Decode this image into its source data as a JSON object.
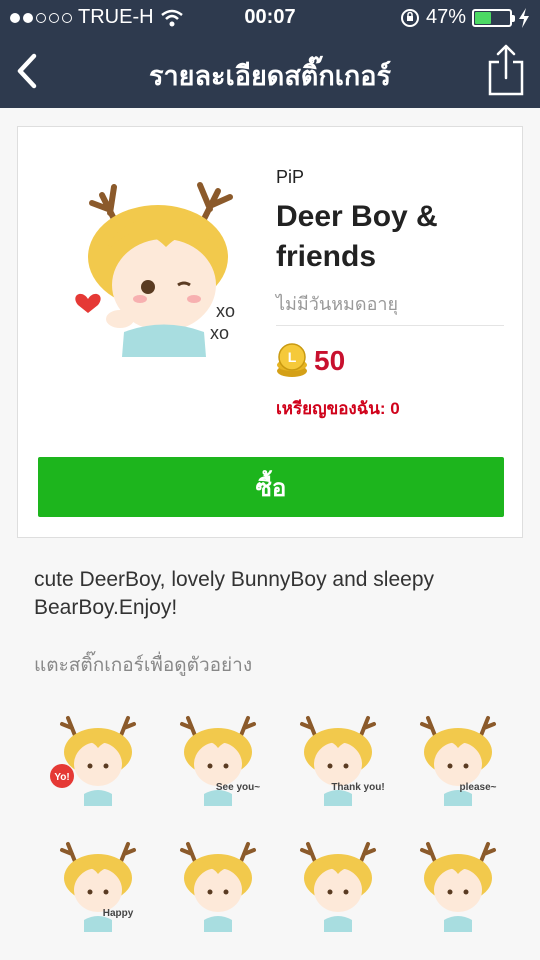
{
  "status_bar": {
    "carrier": "TRUE-H",
    "time": "00:07",
    "battery_percent": "47%",
    "battery_level": 0.47,
    "icons": [
      "signal-dots-icon",
      "wifi-icon",
      "orientation-lock-icon",
      "battery-icon",
      "charging-bolt-icon"
    ]
  },
  "nav": {
    "title": "รายละเอียดสติ๊กเกอร์",
    "back_icon": "chevron-left-icon",
    "share_icon": "share-icon"
  },
  "product": {
    "author": "PiP",
    "title": "Deer Boy & friends",
    "expiry": "ไม่มีวันหมดอายุ",
    "price": "50",
    "my_coins": "เหรียญของฉัน: 0",
    "buy_label": "ซื้อ"
  },
  "description": "cute DeerBoy, lovely BunnyBoy and sleepy BearBoy.Enjoy!",
  "preview_hint": "แตะสติ๊กเกอร์เพื่อดูตัวอย่าง",
  "stickers": [
    {
      "caption": "Yo!"
    },
    {
      "caption": "See you~"
    },
    {
      "caption": "Thank you!"
    },
    {
      "caption": "please~"
    },
    {
      "caption": "Happy"
    },
    {
      "caption": ""
    },
    {
      "caption": ""
    },
    {
      "caption": ""
    }
  ],
  "colors": {
    "nav_bg": "#2e3a4e",
    "buy_button": "#1db51d",
    "price": "#c8102e",
    "battery_fill": "#4cd964"
  }
}
